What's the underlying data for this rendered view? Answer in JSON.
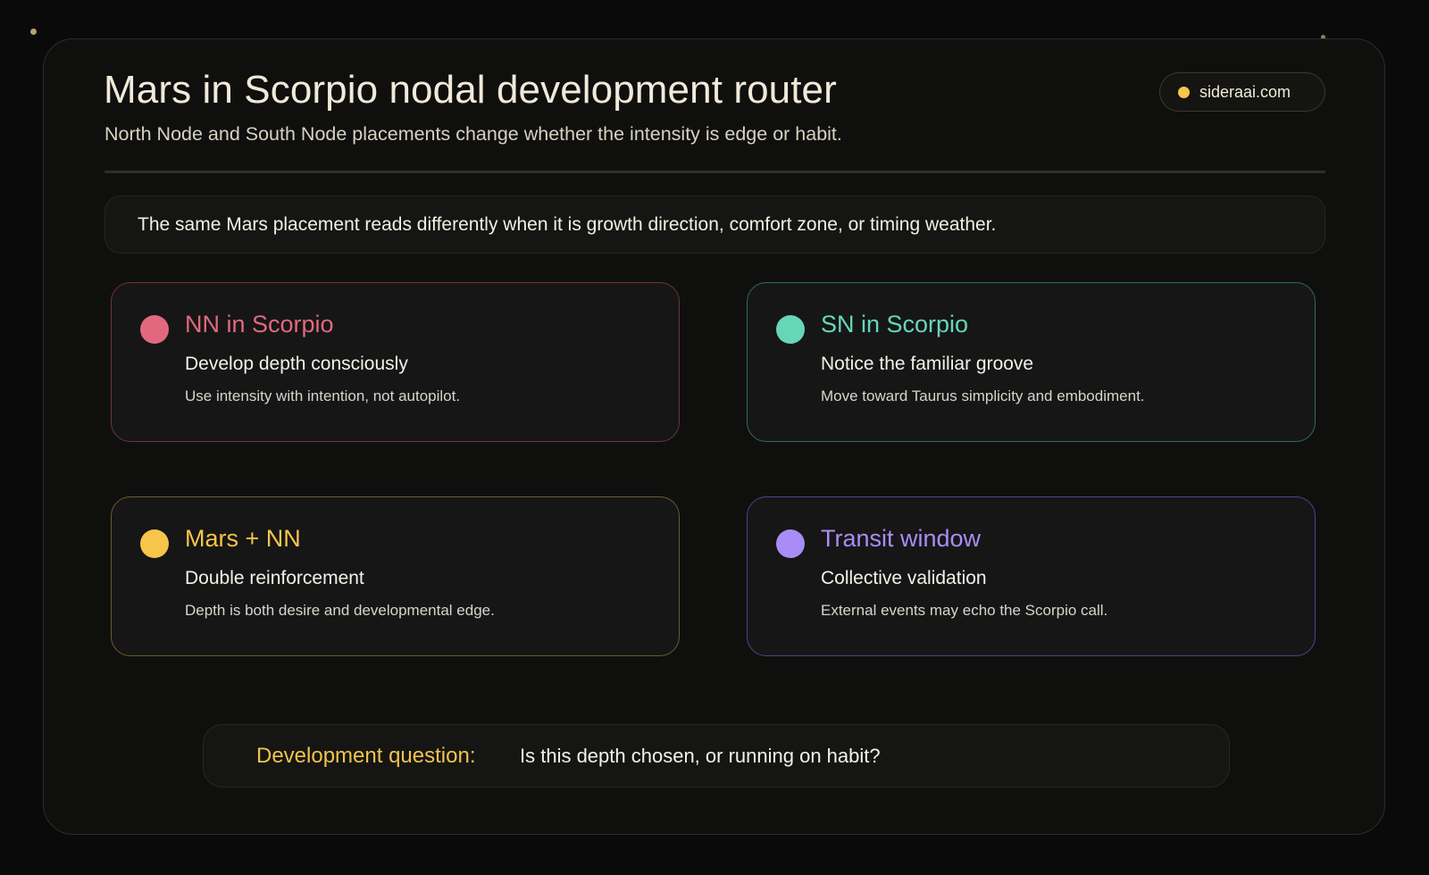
{
  "header": {
    "title": "Mars in Scorpio nodal development router",
    "subtitle": "North Node and South Node placements change whether the intensity is edge or habit.",
    "site_badge": "sideraai.com"
  },
  "intro": "The same Mars placement reads differently when it is growth direction, comfort zone, or timing weather.",
  "cards": [
    {
      "title": "NN in Scorpio",
      "subtitle": "Develop depth consciously",
      "description": "Use intensity with intention, not autopilot.",
      "accent_color": "#e0697f",
      "border_color": "#6e3240"
    },
    {
      "title": "SN in Scorpio",
      "subtitle": "Notice the familiar groove",
      "description": "Move toward Taurus simplicity and embodiment.",
      "accent_color": "#67d6b8",
      "border_color": "#2f6b5b"
    },
    {
      "title": "Mars + NN",
      "subtitle": "Double reinforcement",
      "description": "Depth is both desire and developmental edge.",
      "accent_color": "#f6c54a",
      "border_color": "#6b5a2c"
    },
    {
      "title": "Transit window",
      "subtitle": "Collective validation",
      "description": "External events may echo the Scorpio call.",
      "accent_color": "#a98df7",
      "border_color": "#4f4290"
    }
  ],
  "question": {
    "label": "Development question:",
    "text": "Is this depth chosen, or running on habit?"
  },
  "colors": {
    "background": "#0a0a0a",
    "panel": "#0f100e",
    "gold_accent": "#f6c54a"
  }
}
